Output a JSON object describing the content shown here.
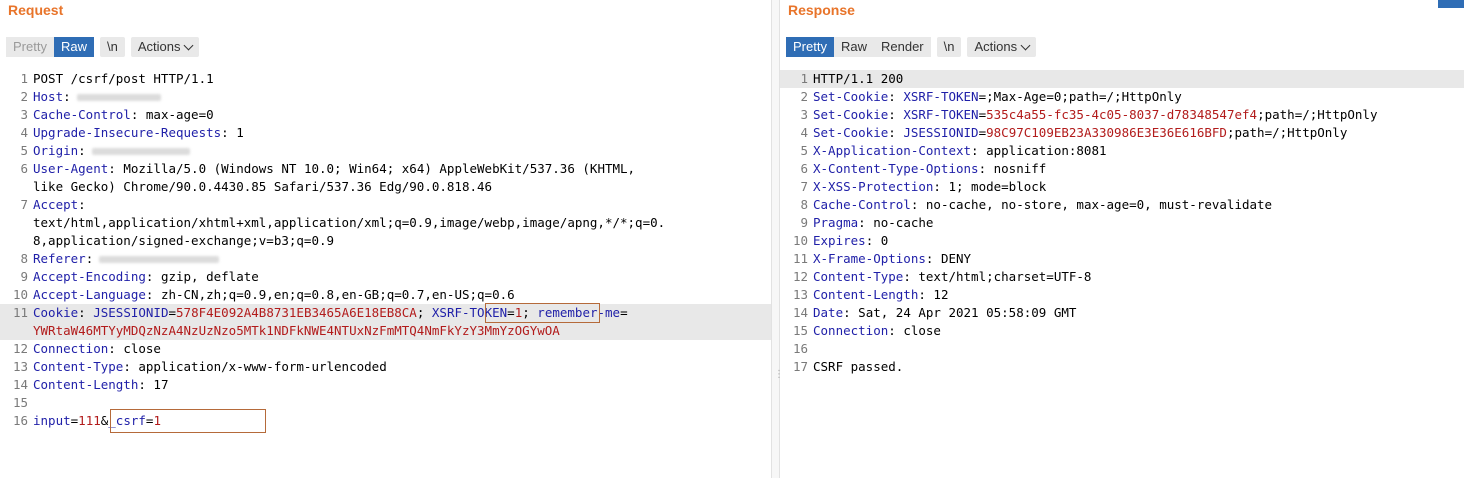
{
  "request": {
    "title": "Request",
    "tabs": {
      "pretty": "Pretty",
      "raw": "Raw",
      "newline": "\\n",
      "actions": "Actions"
    },
    "lines": [
      {
        "n": "1",
        "h": "POST /csrf/post HTTP/1.1",
        "v": ""
      },
      {
        "n": "2",
        "h": "Host",
        "v": ""
      },
      {
        "n": "3",
        "h": "Cache-Control",
        "v": " max-age=0"
      },
      {
        "n": "4",
        "h": "Upgrade-Insecure-Requests",
        "v": " 1"
      },
      {
        "n": "5",
        "h": "Origin",
        "v": ""
      },
      {
        "n": "6",
        "h": "User-Agent",
        "v": " Mozilla/5.0 (Windows NT 10.0; Win64; x64) AppleWebKit/537.36 (KHTML,"
      },
      {
        "n": "",
        "h": "",
        "v": "like Gecko) Chrome/90.0.4430.85 Safari/537.36 Edg/90.0.818.46"
      },
      {
        "n": "7",
        "h": "Accept",
        "v": ""
      },
      {
        "n": "",
        "h": "",
        "v": "text/html,application/xhtml+xml,application/xml;q=0.9,image/webp,image/apng,*/*;q=0."
      },
      {
        "n": "",
        "h": "",
        "v": "8,application/signed-exchange;v=b3;q=0.9"
      },
      {
        "n": "8",
        "h": "Referer",
        "v": ""
      },
      {
        "n": "9",
        "h": "Accept-Encoding",
        "v": " gzip, deflate"
      },
      {
        "n": "10",
        "h": "Accept-Language",
        "v": " zh-CN,zh;q=0.9,en;q=0.8,en-GB;q=0.7,en-US;q=0.6"
      },
      {
        "n": "11",
        "h": "Cookie",
        "v": ""
      },
      {
        "n": "",
        "h": "",
        "v": ""
      },
      {
        "n": "12",
        "h": "Connection",
        "v": " close"
      },
      {
        "n": "13",
        "h": "Content-Type",
        "v": " application/x-www-form-urlencoded"
      },
      {
        "n": "14",
        "h": "Content-Length",
        "v": " 17"
      },
      {
        "n": "15",
        "h": "",
        "v": ""
      },
      {
        "n": "16",
        "h": "",
        "v": ""
      }
    ],
    "cookie": {
      "sess_key": "JSESSIONID",
      "sess_val": "578F4E092A4B8731EB3465A6E18EB8CA",
      "xsrf_key": "XSRF-TOKEN",
      "xsrf_val": "1",
      "remember_key": "remember-me",
      "remember_val": "YWRtaW46MTYyMDQzNzA4NzUzNzo5MTk1NDFkNWE4NTUxNzFmMTQ4NmFkYzY3MmYzOGYwOA"
    },
    "body": {
      "input_key": "input",
      "input_val": "111",
      "csrf_key": "_csrf",
      "csrf_val": "1"
    }
  },
  "response": {
    "title": "Response",
    "tabs": {
      "pretty": "Pretty",
      "raw": "Raw",
      "render": "Render",
      "newline": "\\n",
      "actions": "Actions"
    },
    "lines": [
      {
        "n": "1",
        "h": "HTTP/1.1 200",
        "v": ""
      },
      {
        "n": "2",
        "h": "Set-Cookie",
        "v": ""
      },
      {
        "n": "3",
        "h": "Set-Cookie",
        "v": ""
      },
      {
        "n": "4",
        "h": "Set-Cookie",
        "v": ""
      },
      {
        "n": "5",
        "h": "X-Application-Context",
        "v": " application:8081"
      },
      {
        "n": "6",
        "h": "X-Content-Type-Options",
        "v": " nosniff"
      },
      {
        "n": "7",
        "h": "X-XSS-Protection",
        "v": " 1; mode=block"
      },
      {
        "n": "8",
        "h": "Cache-Control",
        "v": " no-cache, no-store, max-age=0, must-revalidate"
      },
      {
        "n": "9",
        "h": "Pragma",
        "v": " no-cache"
      },
      {
        "n": "10",
        "h": "Expires",
        "v": " 0"
      },
      {
        "n": "11",
        "h": "X-Frame-Options",
        "v": " DENY"
      },
      {
        "n": "12",
        "h": "Content-Type",
        "v": " text/html;charset=UTF-8"
      },
      {
        "n": "13",
        "h": "Content-Length",
        "v": " 12"
      },
      {
        "n": "14",
        "h": "Date",
        "v": " Sat, 24 Apr 2021 05:58:09 GMT"
      },
      {
        "n": "15",
        "h": "Connection",
        "v": " close"
      },
      {
        "n": "16",
        "h": "",
        "v": ""
      },
      {
        "n": "17",
        "h": "",
        "v": ""
      }
    ],
    "setcookies": [
      {
        "key": "XSRF-TOKEN",
        "val": "",
        "attrs": ";Max-Age=0;path=/;HttpOnly"
      },
      {
        "key": "XSRF-TOKEN",
        "val": "535c4a55-fc35-4c05-8037-d78348547ef4",
        "attrs": ";path=/;HttpOnly"
      },
      {
        "key": "JSESSIONID",
        "val": "98C97C109EB23A330986E3E36E616BFD",
        "attrs": ";path=/;HttpOnly"
      }
    ],
    "body_text": "CSRF passed."
  },
  "colors": {
    "accent_title": "#e8742a",
    "active_tab": "#2f6db5",
    "header_name": "#1f1fa8",
    "value_red": "#b21b1b",
    "highlight_box": "#b56a3a"
  }
}
